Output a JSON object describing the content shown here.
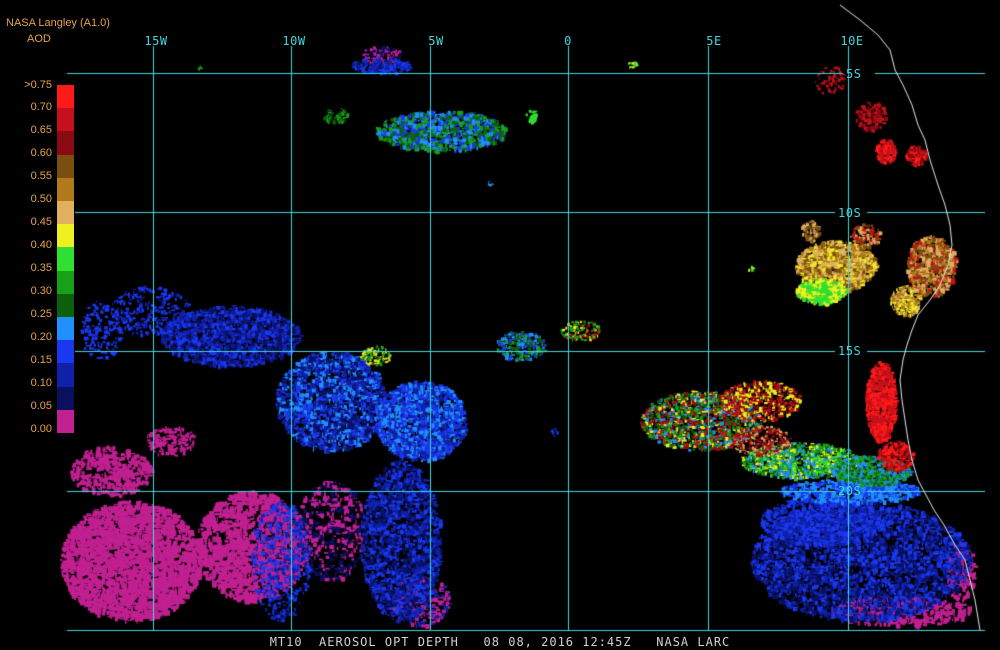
{
  "header": {
    "source": "NASA Langley (A1.0)",
    "product": "AOD"
  },
  "longitudes": [
    "15W",
    "10W",
    "5W",
    "0",
    "5E",
    "10E"
  ],
  "latitudes": [
    "5S",
    "10S",
    "15S",
    "20S"
  ],
  "legend": {
    "labels": [
      ">0.75",
      "0.70",
      "0.65",
      "0.60",
      "0.55",
      "0.50",
      "0.45",
      "0.40",
      "0.35",
      "0.30",
      "0.25",
      "0.20",
      "0.15",
      "0.10",
      "0.05",
      "0.00"
    ],
    "colors": [
      "#ff1a1a",
      "#c4101a",
      "#8a0a12",
      "#7a4e10",
      "#b07a1a",
      "#e0b060",
      "#f0f020",
      "#30e030",
      "#18a018",
      "#0c600c",
      "#2090ff",
      "#1a38f0",
      "#1020a8",
      "#0a1060",
      "#c02090"
    ]
  },
  "footer": "MT10  AEROSOL OPT DEPTH   08 08, 2016 12:45Z   NASA LARC"
}
